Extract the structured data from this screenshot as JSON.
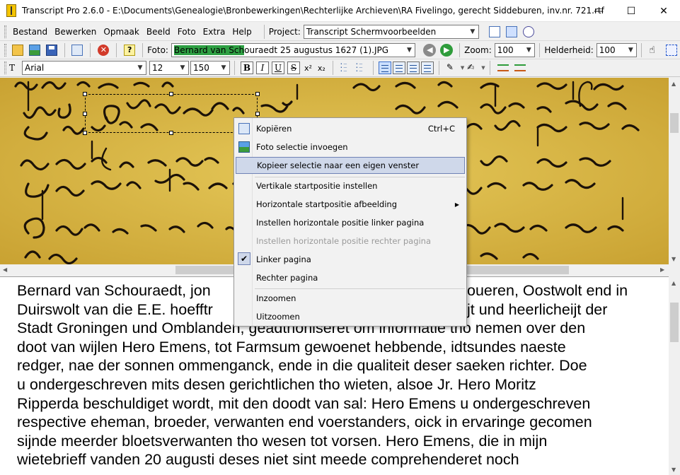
{
  "window": {
    "title": "Transcript Pro 2.6.0 - E:\\Documents\\Genealogie\\Bronbewerkingen\\Rechterlijke Archieven\\RA Fivelingo, gerecht Siddeburen, inv.nr. 721.rtf",
    "minimize": "—",
    "maximize": "☐",
    "close": "✕"
  },
  "menu": {
    "items": [
      "Bestand",
      "Bewerken",
      "Opmaak",
      "Beeld",
      "Foto",
      "Extra",
      "Help"
    ]
  },
  "project": {
    "label": "Project:",
    "value": "Transcript Schermvoorbeelden"
  },
  "photo": {
    "label": "Foto:",
    "value_highlight": "Bernard van Sch",
    "value_rest": "ouraedt 25 augustus 1627 (1).JPG"
  },
  "zoom": {
    "label": "Zoom:",
    "value": "100"
  },
  "brightness": {
    "label": "Helderheid:",
    "value": "100"
  },
  "format": {
    "font": "Arial",
    "size": "12",
    "width": "150",
    "bold": "B",
    "italic": "I",
    "underline": "U",
    "strike": "S",
    "superscript": "x²",
    "subscript": "x₂"
  },
  "context_menu": {
    "copy": "Kopiëren",
    "copy_shortcut": "Ctrl+C",
    "insert_photo_selection": "Foto selectie invoegen",
    "copy_to_window": "Kopieer selectie naar een eigen venster",
    "vertical_start": "Vertikale startpositie instellen",
    "horizontal_start_image": "Horizontale startpositie afbeelding",
    "horizontal_left_page": "Instellen horizontale positie linker pagina",
    "horizontal_right_page": "Instellen horizontale positie rechter pagina",
    "left_page": "Linker pagina",
    "right_page": "Rechter pagina",
    "zoom_in": "Inzoomen",
    "zoom_out": "Uitzoomen"
  },
  "transcript": {
    "lines": [
      "Bernard van Schouraedt, jon",
      "Duirswolt van die E.E. hoefftr",
      "Stadt Groningen und Omblanden, geadthoniseret om informatie tho nemen over den",
      "doot van wijlen Hero Emens, tot Farmsum gewoenet hebbende, idtsundes naeste",
      "redger, nae der sonnen ommenganck, ende in die qualiteit deser saeken richter. Doe",
      "u ondergeschreven mits desen gerichtlichen tho wieten, alsoe Jr. Hero Moritz",
      "Ripperda beschuldiget wordt, mit den doodt van sal: Hero Emens u ondergeschreven",
      "respective eheman, broeder, verwanten end voerstanders, oick in ervaringe gecomen",
      "sijnde meerder bloetsverwanten tho wesen tot vorsen. Hero Emens, die in mijn",
      "wietebrieff vanden 20 augusti deses niet sint meede comprehenderet noch"
    ],
    "line0_right": "oueren, Oostwolt end in",
    "line1_right": "jt und heerlicheijt der"
  }
}
